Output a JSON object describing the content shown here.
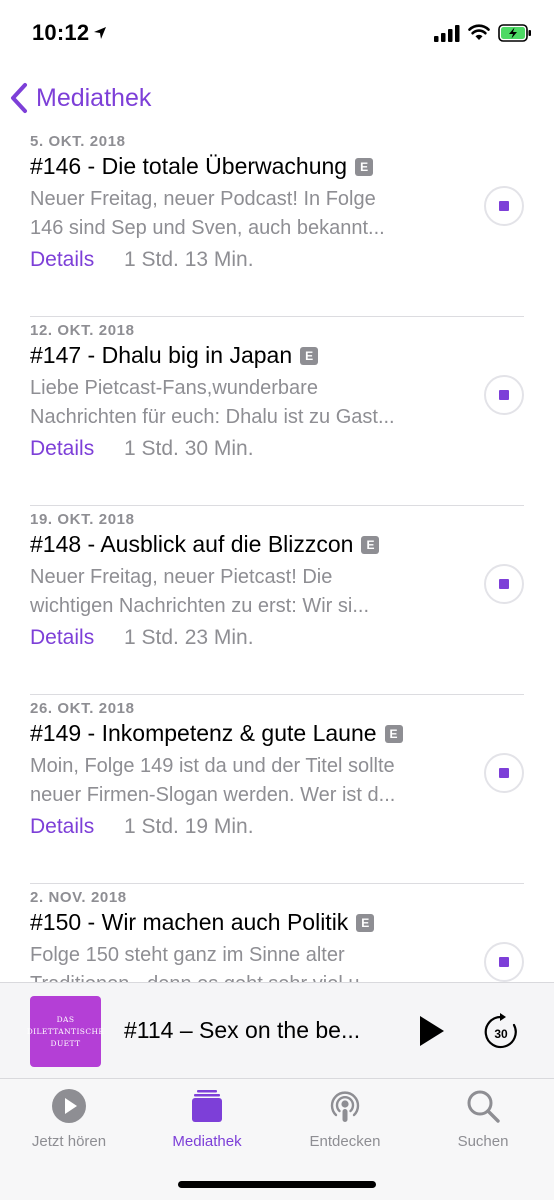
{
  "status_bar": {
    "time": "10:12"
  },
  "nav": {
    "back_label": "Mediathek"
  },
  "episodes": [
    {
      "date": "5. OKT. 2018",
      "title": "#146 - Die totale Überwachung",
      "explicit": "E",
      "desc_line1": "Neuer Freitag, neuer Podcast! In Folge",
      "desc_line2": "146 sind Sep und Sven, auch bekannt...",
      "details": "Details",
      "duration": "1 Std. 13 Min."
    },
    {
      "date": "12. OKT. 2018",
      "title": "#147 - Dhalu big in Japan",
      "explicit": "E",
      "desc_line1": "Liebe Pietcast-Fans,wunderbare",
      "desc_line2": "Nachrichten für euch: Dhalu ist zu Gast...",
      "details": "Details",
      "duration": "1 Std. 30 Min."
    },
    {
      "date": "19. OKT. 2018",
      "title": "#148 - Ausblick auf die Blizzcon",
      "explicit": "E",
      "desc_line1": "Neuer Freitag, neuer Pietcast! Die",
      "desc_line2": "wichtigen Nachrichten zu erst: Wir si...",
      "details": "Details",
      "duration": "1 Std. 23 Min."
    },
    {
      "date": "26. OKT. 2018",
      "title": "#149 - Inkompetenz & gute Laune",
      "explicit": "E",
      "desc_line1": "Moin, Folge 149 ist da und der Titel sollte",
      "desc_line2": "neuer Firmen-Slogan werden. Wer ist d...",
      "details": "Details",
      "duration": "1 Std. 19 Min."
    },
    {
      "date": "2. NOV. 2018",
      "title": "#150 - Wir machen auch Politik",
      "explicit": "E",
      "desc_line1": "Folge 150 steht ganz im Sinne alter",
      "desc_line2": "Traditionen - denn es geht sehr viel u...",
      "details": "",
      "duration": ""
    }
  ],
  "mini_player": {
    "artwork_line1": "DAS",
    "artwork_line2": "DILETTANTISCHE",
    "artwork_line3": "DUETT",
    "title": "#114 – Sex on the be...",
    "skip_seconds": "30"
  },
  "tabs": [
    {
      "label": "Jetzt hören",
      "icon": "play-circle-icon",
      "active": false
    },
    {
      "label": "Mediathek",
      "icon": "library-icon",
      "active": true
    },
    {
      "label": "Entdecken",
      "icon": "podcast-icon",
      "active": false
    },
    {
      "label": "Suchen",
      "icon": "search-icon",
      "active": false
    }
  ],
  "colors": {
    "accent": "#7d3fd8",
    "secondary_text": "#8e8e93",
    "artwork": "#b43fd6"
  }
}
